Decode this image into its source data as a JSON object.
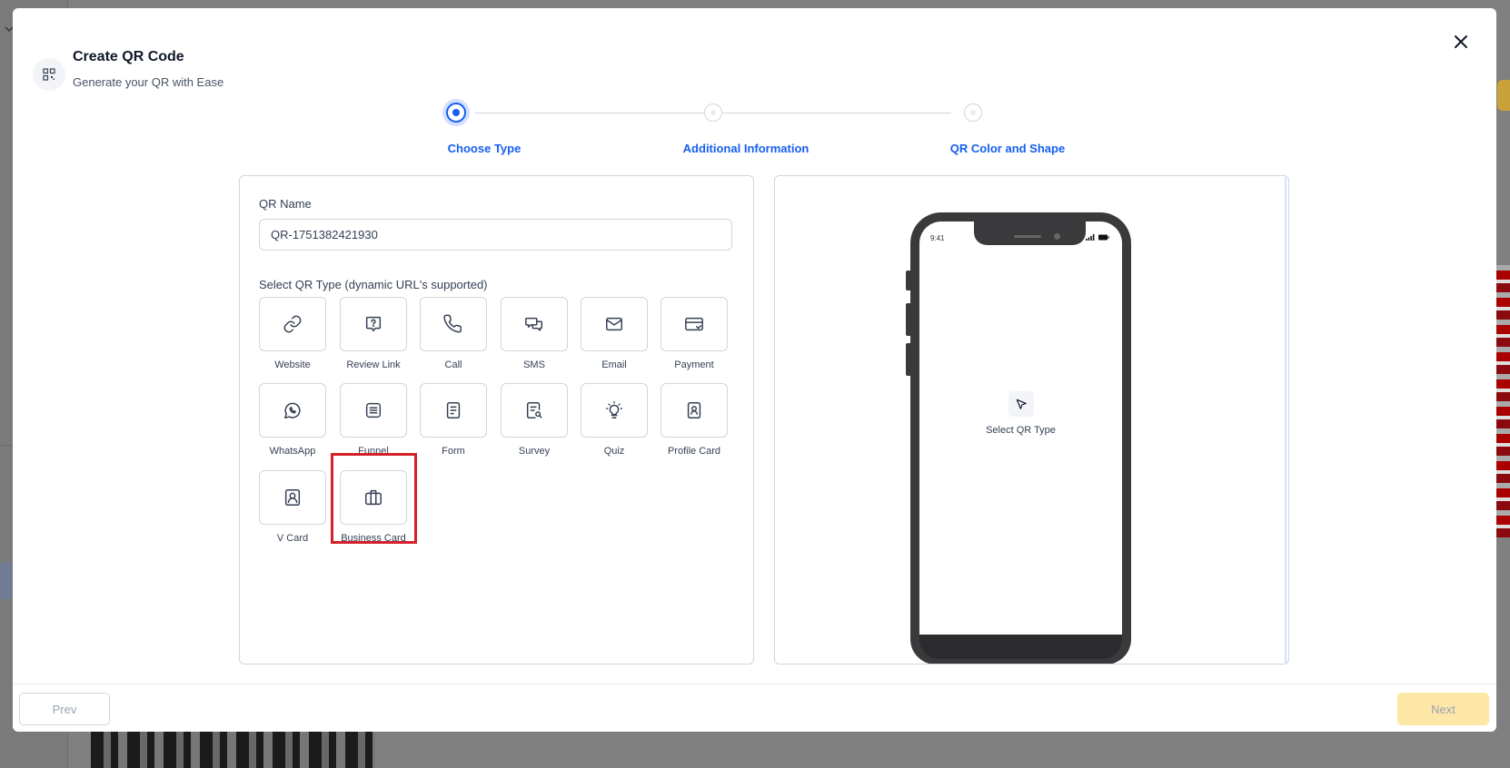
{
  "modal": {
    "title": "Create QR Code",
    "subtitle": "Generate your QR with Ease"
  },
  "steps": [
    {
      "label": "Choose Type",
      "state": "active"
    },
    {
      "label": "Additional Information",
      "state": "inactive"
    },
    {
      "label": "QR Color and Shape",
      "state": "inactive"
    }
  ],
  "form": {
    "qr_name_label": "QR Name",
    "qr_name_value": "QR-1751382421930",
    "type_label": "Select QR Type (dynamic URL's supported)"
  },
  "qr_types": [
    {
      "label": "Website",
      "icon": "link-icon"
    },
    {
      "label": "Review Link",
      "icon": "review-icon"
    },
    {
      "label": "Call",
      "icon": "phone-icon"
    },
    {
      "label": "SMS",
      "icon": "sms-icon"
    },
    {
      "label": "Email",
      "icon": "mail-icon"
    },
    {
      "label": "Payment",
      "icon": "payment-card-icon"
    },
    {
      "label": "WhatsApp",
      "icon": "whatsapp-icon"
    },
    {
      "label": "Funnel",
      "icon": "funnel-icon"
    },
    {
      "label": "Form",
      "icon": "form-icon"
    },
    {
      "label": "Survey",
      "icon": "survey-icon"
    },
    {
      "label": "Quiz",
      "icon": "lightbulb-icon"
    },
    {
      "label": "Profile Card",
      "icon": "profile-card-icon"
    },
    {
      "label": "V Card",
      "icon": "vcard-icon"
    },
    {
      "label": "Business Card",
      "icon": "briefcase-icon"
    }
  ],
  "preview": {
    "phone_time": "9:41",
    "label": "Select QR Type"
  },
  "footer": {
    "prev_label": "Prev",
    "next_label": "Next"
  },
  "colors": {
    "accent": "#155eef",
    "highlight": "#d32029",
    "next_bg": "#fde7a7"
  }
}
